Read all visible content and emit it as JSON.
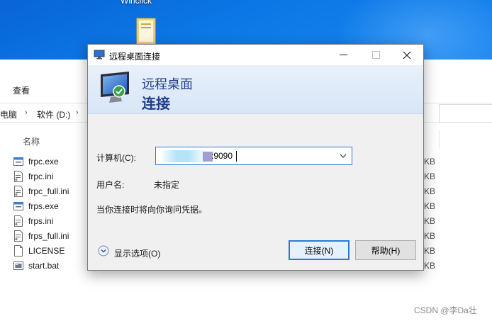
{
  "desktop": {
    "icon_label": "Winclick"
  },
  "explorer": {
    "ribbon_tab": "查看",
    "breadcrumb": [
      "电脑",
      "软件 (D:)"
    ],
    "column_name": "名称",
    "size_unit": "KB",
    "files": [
      {
        "name": "frpc.exe",
        "icon": "exe-icon"
      },
      {
        "name": "frpc.ini",
        "icon": "ini-file-icon"
      },
      {
        "name": "frpc_full.ini",
        "icon": "ini-file-icon"
      },
      {
        "name": "frps.exe",
        "icon": "exe-icon"
      },
      {
        "name": "frps.ini",
        "icon": "ini-file-icon"
      },
      {
        "name": "frps_full.ini",
        "icon": "ini-file-icon"
      },
      {
        "name": "LICENSE",
        "icon": "blank-file-icon"
      },
      {
        "name": "start.bat",
        "icon": "bat-file-icon"
      }
    ]
  },
  "dialog": {
    "title": "远程桌面连接",
    "banner_line1": "远程桌面",
    "banner_line2": "连接",
    "computer_label": "计算机(C):",
    "computer_value": ":9090",
    "username_label": "用户名:",
    "username_value": "未指定",
    "info_text": "当你连接时将向你询问凭据。",
    "show_options": "显示选项(O)",
    "connect_button": "连接(N)",
    "help_button": "帮助(H)",
    "accent_color": "#2d7ad6",
    "banner_text_color": "#1f3d8a"
  },
  "watermark": "CSDN @李Da壮"
}
